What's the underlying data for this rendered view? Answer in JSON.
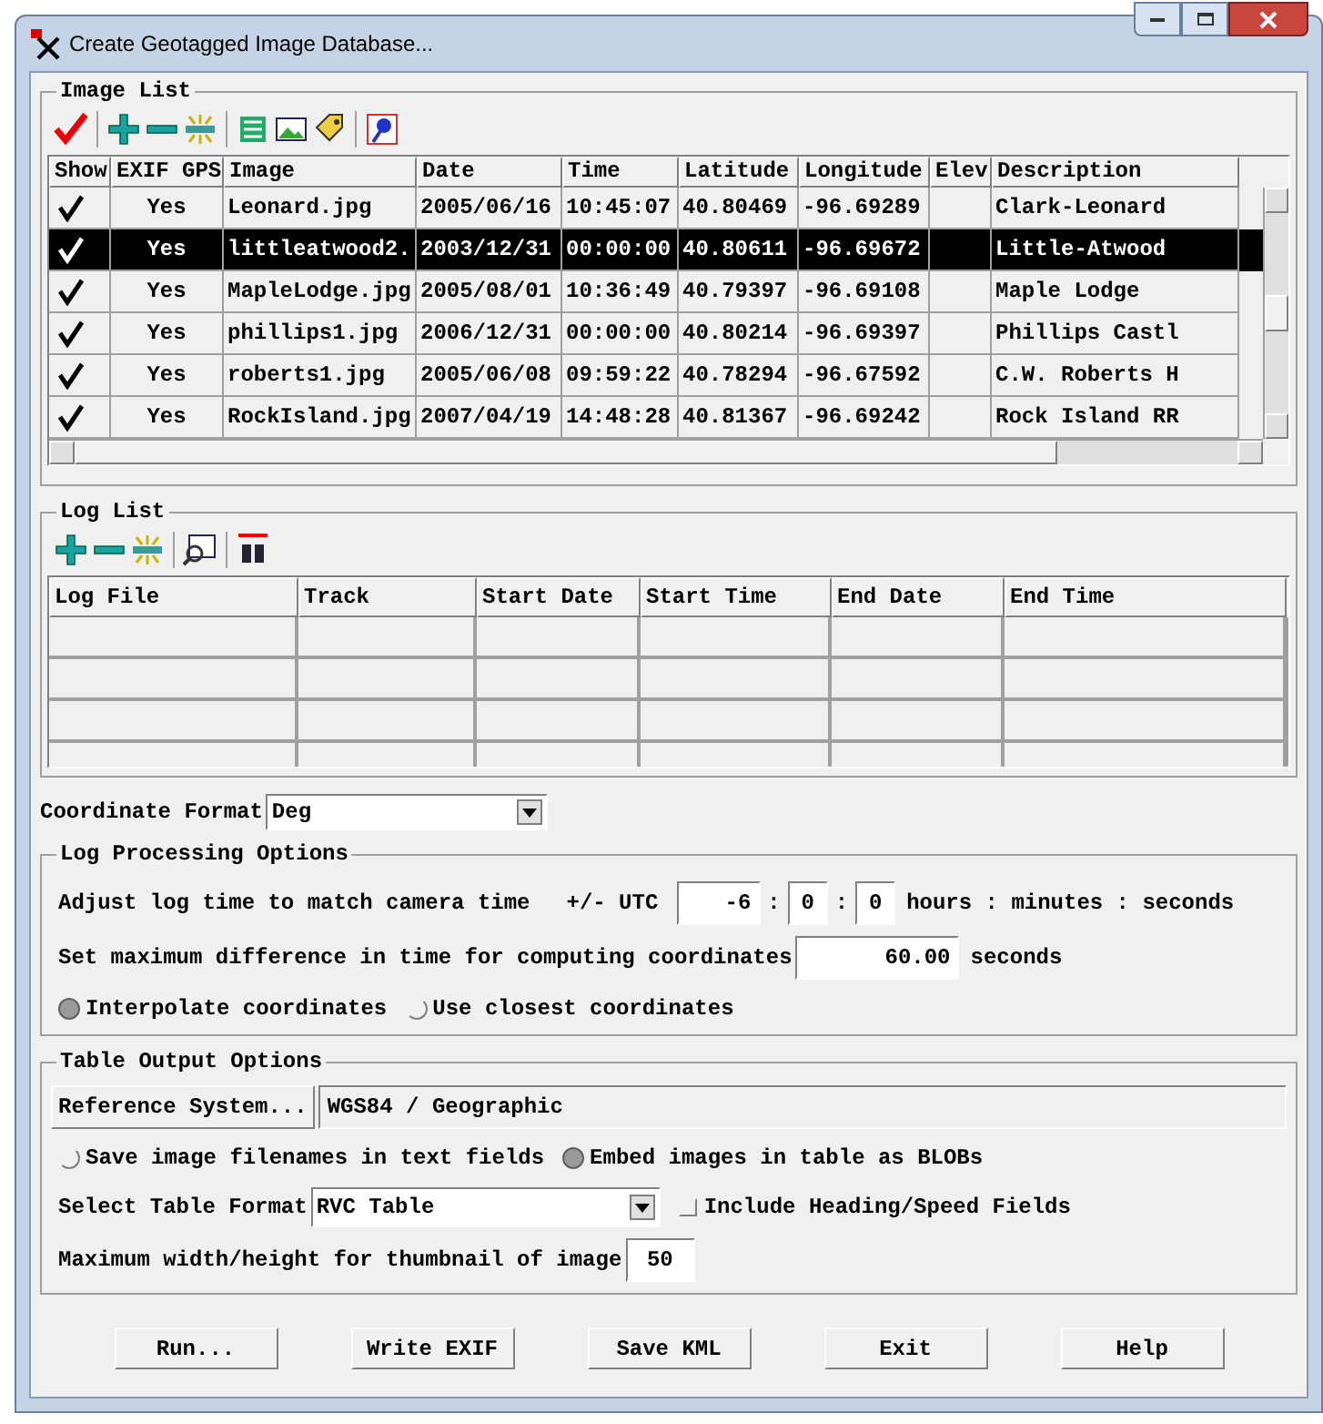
{
  "window": {
    "title": "Create Geotagged Image Database..."
  },
  "image_list": {
    "title": "Image List",
    "columns": [
      "Show",
      "EXIF GPS",
      "Image",
      "Date",
      "Time",
      "Latitude",
      "Longitude",
      "Elev",
      "Description"
    ],
    "rows": [
      {
        "show": true,
        "exif_gps": "Yes",
        "image": "Leonard.jpg",
        "date": "2005/06/16",
        "time": "10:45:07",
        "latitude": "40.80469",
        "longitude": "-96.69289",
        "description": "Clark-Leonard",
        "selected": false
      },
      {
        "show": true,
        "exif_gps": "Yes",
        "image": "littleatwood2.",
        "date": "2003/12/31",
        "time": "00:00:00",
        "latitude": "40.80611",
        "longitude": "-96.69672",
        "description": "Little-Atwood",
        "selected": true
      },
      {
        "show": true,
        "exif_gps": "Yes",
        "image": "MapleLodge.jpg",
        "date": "2005/08/01",
        "time": "10:36:49",
        "latitude": "40.79397",
        "longitude": "-96.69108",
        "description": "Maple Lodge",
        "selected": false
      },
      {
        "show": true,
        "exif_gps": "Yes",
        "image": "phillips1.jpg",
        "date": "2006/12/31",
        "time": "00:00:00",
        "latitude": "40.80214",
        "longitude": "-96.69397",
        "description": "Phillips Castl",
        "selected": false
      },
      {
        "show": true,
        "exif_gps": "Yes",
        "image": "roberts1.jpg",
        "date": "2005/06/08",
        "time": "09:59:22",
        "latitude": "40.78294",
        "longitude": "-96.67592",
        "description": "C.W. Roberts H",
        "selected": false
      },
      {
        "show": true,
        "exif_gps": "Yes",
        "image": "RockIsland.jpg",
        "date": "2007/04/19",
        "time": "14:48:28",
        "latitude": "40.81367",
        "longitude": "-96.69242",
        "description": "Rock Island RR",
        "selected": false
      }
    ]
  },
  "log_list": {
    "title": "Log List",
    "columns": [
      "Log File",
      "Track",
      "Start Date",
      "Start Time",
      "End Date",
      "End Time"
    ]
  },
  "coordinate_format": {
    "label": "Coordinate Format",
    "value": "Deg"
  },
  "log_processing": {
    "title": "Log Processing Options",
    "adjust_label": "Adjust log time to match camera time",
    "utc_label": "+/- UTC",
    "hours": "-6",
    "sep_1": ":",
    "minutes": "0",
    "sep_2": ":",
    "seconds": "0",
    "units": "hours : minutes : seconds",
    "max_diff_label": "Set maximum difference in time for computing coordinates",
    "max_diff_value": "60.00",
    "max_diff_units": "seconds",
    "radios": [
      {
        "label": "Interpolate coordinates",
        "selected": true
      },
      {
        "label": "Use closest coordinates",
        "selected": false
      }
    ]
  },
  "table_output": {
    "title": "Table Output Options",
    "reference_button": "Reference System...",
    "reference_value": "WGS84 / Geographic",
    "storage_radios": [
      {
        "label": "Save image filenames in text fields",
        "selected": false
      },
      {
        "label": "Embed images in table as BLOBs",
        "selected": true
      }
    ],
    "format_label": "Select Table Format",
    "format_value": "RVC Table",
    "heading_checkbox": {
      "label": "Include Heading/Speed Fields",
      "checked": false
    },
    "thumbnail_label": "Maximum width/height for thumbnail of image",
    "thumbnail_value": "50"
  },
  "buttons": [
    "Run...",
    "Write EXIF",
    "Save KML",
    "Exit",
    "Help"
  ]
}
